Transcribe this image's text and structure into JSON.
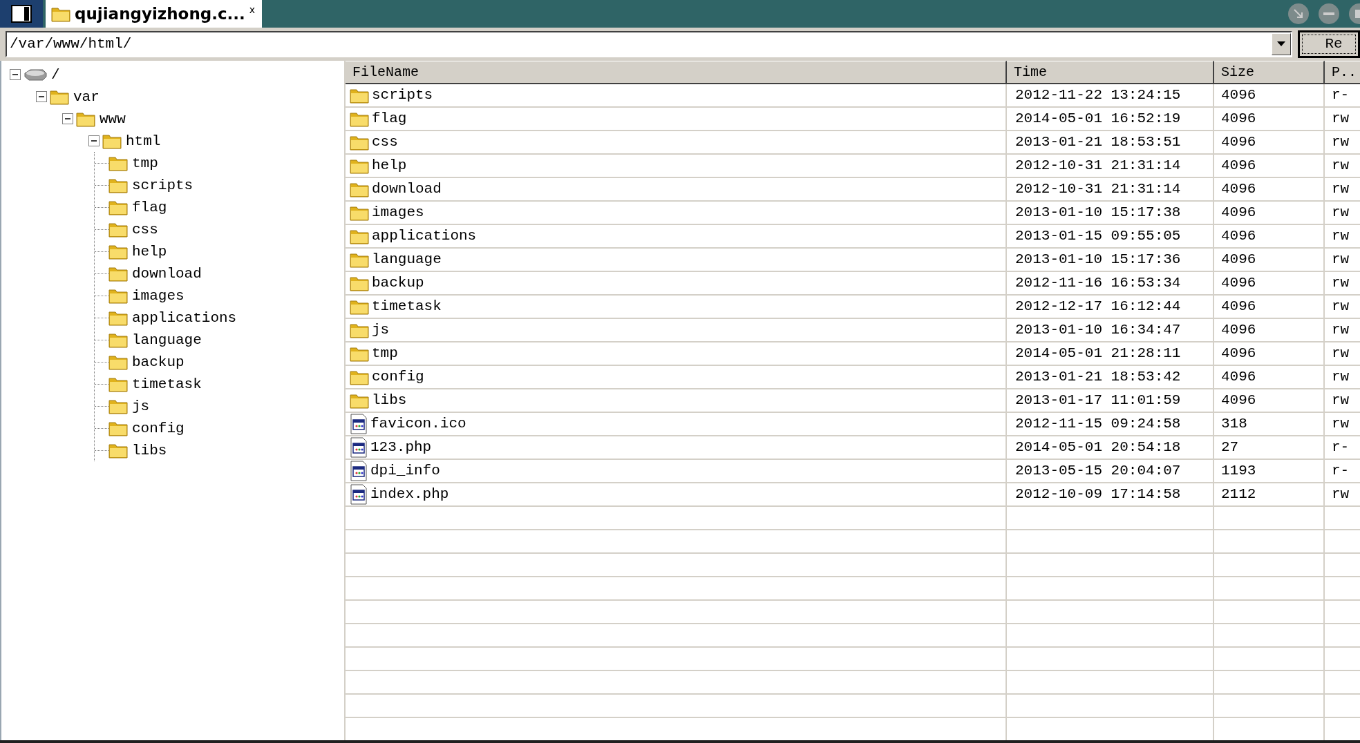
{
  "tab": {
    "title": "qujiangyizhong.c...",
    "close": "x"
  },
  "address": {
    "value": "/var/www/html/",
    "button": "Re"
  },
  "tree": {
    "label": "/",
    "kind": "drive",
    "expanded": true,
    "children": [
      {
        "label": "var",
        "kind": "folder",
        "expanded": true,
        "children": [
          {
            "label": "www",
            "kind": "folder",
            "expanded": true,
            "children": [
              {
                "label": "html",
                "kind": "folder",
                "expanded": true,
                "children": [
                  {
                    "label": "tmp",
                    "kind": "folder"
                  },
                  {
                    "label": "scripts",
                    "kind": "folder"
                  },
                  {
                    "label": "flag",
                    "kind": "folder"
                  },
                  {
                    "label": "css",
                    "kind": "folder"
                  },
                  {
                    "label": "help",
                    "kind": "folder"
                  },
                  {
                    "label": "download",
                    "kind": "folder"
                  },
                  {
                    "label": "images",
                    "kind": "folder"
                  },
                  {
                    "label": "applications",
                    "kind": "folder"
                  },
                  {
                    "label": "language",
                    "kind": "folder"
                  },
                  {
                    "label": "backup",
                    "kind": "folder"
                  },
                  {
                    "label": "timetask",
                    "kind": "folder"
                  },
                  {
                    "label": "js",
                    "kind": "folder"
                  },
                  {
                    "label": "config",
                    "kind": "folder"
                  },
                  {
                    "label": "libs",
                    "kind": "folder"
                  }
                ]
              }
            ]
          }
        ]
      }
    ]
  },
  "table": {
    "columns": [
      "FileName",
      "Time",
      "Size",
      "P.."
    ],
    "rows": [
      {
        "kind": "folder",
        "name": "scripts",
        "time": "2012-11-22 13:24:15",
        "size": "4096",
        "perm": "r-"
      },
      {
        "kind": "folder",
        "name": "flag",
        "time": "2014-05-01 16:52:19",
        "size": "4096",
        "perm": "rw"
      },
      {
        "kind": "folder",
        "name": "css",
        "time": "2013-01-21 18:53:51",
        "size": "4096",
        "perm": "rw"
      },
      {
        "kind": "folder",
        "name": "help",
        "time": "2012-10-31 21:31:14",
        "size": "4096",
        "perm": "rw"
      },
      {
        "kind": "folder",
        "name": "download",
        "time": "2012-10-31 21:31:14",
        "size": "4096",
        "perm": "rw"
      },
      {
        "kind": "folder",
        "name": "images",
        "time": "2013-01-10 15:17:38",
        "size": "4096",
        "perm": "rw"
      },
      {
        "kind": "folder",
        "name": "applications",
        "time": "2013-01-15 09:55:05",
        "size": "4096",
        "perm": "rw"
      },
      {
        "kind": "folder",
        "name": "language",
        "time": "2013-01-10 15:17:36",
        "size": "4096",
        "perm": "rw"
      },
      {
        "kind": "folder",
        "name": "backup",
        "time": "2012-11-16 16:53:34",
        "size": "4096",
        "perm": "rw"
      },
      {
        "kind": "folder",
        "name": "timetask",
        "time": "2012-12-17 16:12:44",
        "size": "4096",
        "perm": "rw"
      },
      {
        "kind": "folder",
        "name": "js",
        "time": "2013-01-10 16:34:47",
        "size": "4096",
        "perm": "rw"
      },
      {
        "kind": "folder",
        "name": "tmp",
        "time": "2014-05-01 21:28:11",
        "size": "4096",
        "perm": "rw"
      },
      {
        "kind": "folder",
        "name": "config",
        "time": "2013-01-21 18:53:42",
        "size": "4096",
        "perm": "rw"
      },
      {
        "kind": "folder",
        "name": "libs",
        "time": "2013-01-17 11:01:59",
        "size": "4096",
        "perm": "rw"
      },
      {
        "kind": "file",
        "name": "favicon.ico",
        "time": "2012-11-15 09:24:58",
        "size": "318",
        "perm": "rw"
      },
      {
        "kind": "file",
        "name": "123.php",
        "time": "2014-05-01 20:54:18",
        "size": "27",
        "perm": "r-"
      },
      {
        "kind": "file",
        "name": "dpi_info",
        "time": "2013-05-15 20:04:07",
        "size": "1193",
        "perm": "r-"
      },
      {
        "kind": "file",
        "name": "index.php",
        "time": "2012-10-09 17:14:58",
        "size": "2112",
        "perm": "rw"
      }
    ]
  }
}
